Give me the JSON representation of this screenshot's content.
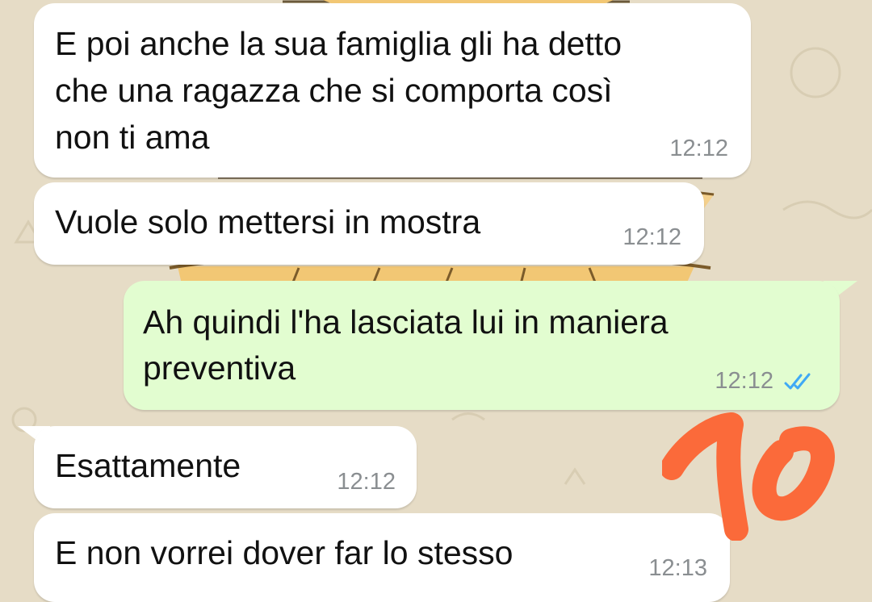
{
  "messages": [
    {
      "direction": "incoming",
      "lines": [
        "E poi anche la sua famiglia gli ha detto",
        "che una ragazza che si comporta così",
        "non ti ama"
      ],
      "time": "12:12"
    },
    {
      "direction": "incoming",
      "lines": [
        "Vuole solo mettersi in mostra"
      ],
      "time": "12:12"
    },
    {
      "direction": "outgoing",
      "lines": [
        "Ah quindi l'ha lasciata lui in maniera",
        "preventiva"
      ],
      "time": "12:12",
      "status": "read",
      "status_icon": "double-check-icon"
    },
    {
      "direction": "incoming",
      "lines": [
        "Esattamente"
      ],
      "time": "12:12"
    },
    {
      "direction": "incoming",
      "lines": [
        "E non vorrei dover far lo stesso"
      ],
      "time": "12:13"
    }
  ],
  "annotation": {
    "text": "10",
    "color": "#fb6a3a"
  },
  "colors": {
    "incoming_bubble": "#ffffff",
    "outgoing_bubble": "#e2fdd0",
    "wallpaper": "#e6dcc6",
    "timestamp": "#8a8e91",
    "read_ticks": "#3fa9f5"
  }
}
